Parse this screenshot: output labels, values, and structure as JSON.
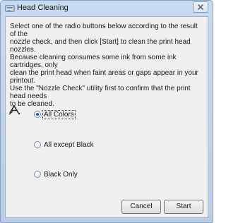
{
  "window": {
    "title": "Head Cleaning"
  },
  "instructions": "Select one of the radio buttons below according to the result of the\nnozzle check, and then click [Start] to clean the print head nozzles.\nBecause cleaning consumes some ink from some ink cartridges, only\nclean the print head when faint areas or gaps appear in your printout.\nUse the \"Nozzle Check\" utility first to confirm that the print head needs\nto be cleaned.",
  "options": [
    {
      "label": "All Colors",
      "checked": true
    },
    {
      "label": "All except Black",
      "checked": false
    },
    {
      "label": "Black Only",
      "checked": false
    }
  ],
  "buttons": {
    "cancel": "Cancel",
    "start": "Start"
  },
  "icons": {
    "title": "printer-head-icon",
    "side": "print-head-nozzle-icon",
    "close": "close-icon"
  },
  "colors": {
    "accent": "#1d5fb5",
    "close_glyph": "#5a6a80"
  }
}
